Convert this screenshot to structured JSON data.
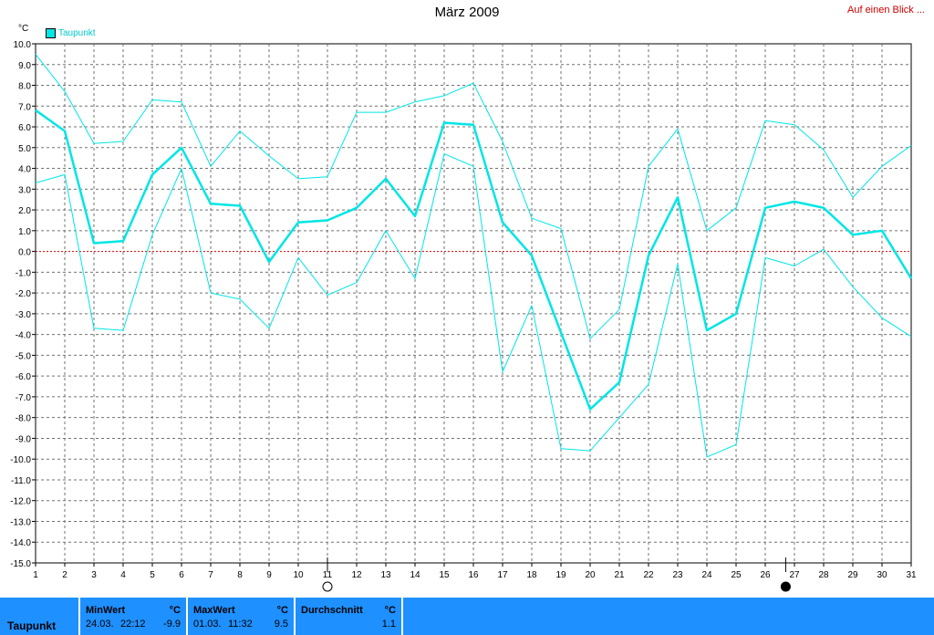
{
  "header": {
    "title": "März 2009",
    "link": "Auf einen Blick ...",
    "unit": "°C",
    "legend": "Taupunkt"
  },
  "colors": {
    "series": "#00e5e5",
    "grid": "#707070",
    "zero_line": "#cc0000",
    "stats_bg": "#1e90ff"
  },
  "chart_data": {
    "type": "line",
    "xlabel": "",
    "ylabel": "°C",
    "xlim": [
      1,
      31
    ],
    "ylim": [
      -15,
      10
    ],
    "grid": true,
    "legend_position": "top-left",
    "x": [
      1,
      2,
      3,
      4,
      5,
      6,
      7,
      8,
      9,
      10,
      11,
      12,
      13,
      14,
      15,
      16,
      17,
      18,
      19,
      20,
      21,
      22,
      23,
      24,
      25,
      26,
      27,
      28,
      29,
      30,
      31
    ],
    "x_ticks": [
      "1",
      "2",
      "3",
      "4",
      "5",
      "6",
      "7",
      "8",
      "9",
      "10",
      "11",
      "12",
      "13",
      "14",
      "15",
      "16",
      "17",
      "18",
      "19",
      "20",
      "21",
      "22",
      "23",
      "24",
      "25",
      "26",
      "27",
      "28",
      "29",
      "30",
      "31"
    ],
    "y_ticks": [
      "10.0",
      "9.0",
      "8.0",
      "7.0",
      "6.0",
      "5.0",
      "4.0",
      "3.0",
      "2.0",
      "1.0",
      "0.0",
      "-1.0",
      "-2.0",
      "-3.0",
      "-4.0",
      "-5.0",
      "-6.0",
      "-7.0",
      "-8.0",
      "-9.0",
      "-10.0",
      "-11.0",
      "-12.0",
      "-13.0",
      "-14.0",
      "-15.0"
    ],
    "series": [
      {
        "name": "Taupunkt",
        "values": [
          6.8,
          5.8,
          0.4,
          0.5,
          3.7,
          5.0,
          2.3,
          2.2,
          -0.5,
          1.4,
          1.5,
          2.1,
          3.5,
          1.7,
          6.2,
          6.1,
          1.4,
          -0.2,
          -3.9,
          -7.6,
          -6.3,
          -0.2,
          2.6,
          -3.8,
          -3.0,
          2.1,
          2.4,
          2.1,
          0.8,
          1.0,
          -1.3
        ]
      },
      {
        "values": [
          9.5,
          7.7,
          5.2,
          5.3,
          7.3,
          7.2,
          4.1,
          5.8,
          4.6,
          3.5,
          3.6,
          6.7,
          6.7,
          7.2,
          7.5,
          8.1,
          5.3,
          1.6,
          1.1,
          -4.2,
          -2.8,
          4.1,
          5.9,
          1.0,
          2.1,
          6.3,
          6.1,
          4.9,
          2.6,
          4.1,
          5.1
        ]
      },
      {
        "values": [
          3.3,
          3.7,
          -3.7,
          -3.8,
          0.8,
          4.0,
          -2.0,
          -2.3,
          -3.7,
          -0.3,
          -2.1,
          -1.5,
          1.0,
          -1.3,
          4.7,
          4.1,
          -5.8,
          -2.6,
          -9.5,
          -9.6,
          -8.0,
          -6.4,
          -0.6,
          -9.9,
          -9.3,
          -0.3,
          -0.7,
          0.1,
          -1.7,
          -3.2,
          -4.1
        ]
      }
    ],
    "markers": [
      {
        "x": 11,
        "type": "full-moon"
      },
      {
        "x": 26.7,
        "type": "new-moon"
      }
    ]
  },
  "stats": {
    "row_label": "Taupunkt",
    "min": {
      "label": "MinWert",
      "unit": "°C",
      "date": "24.03.",
      "time": "22:12",
      "value": "-9.9"
    },
    "max": {
      "label": "MaxWert",
      "unit": "°C",
      "date": "01.03.",
      "time": "11:32",
      "value": "9.5"
    },
    "avg": {
      "label": "Durchschnitt",
      "unit": "°C",
      "value": "1.1"
    }
  }
}
